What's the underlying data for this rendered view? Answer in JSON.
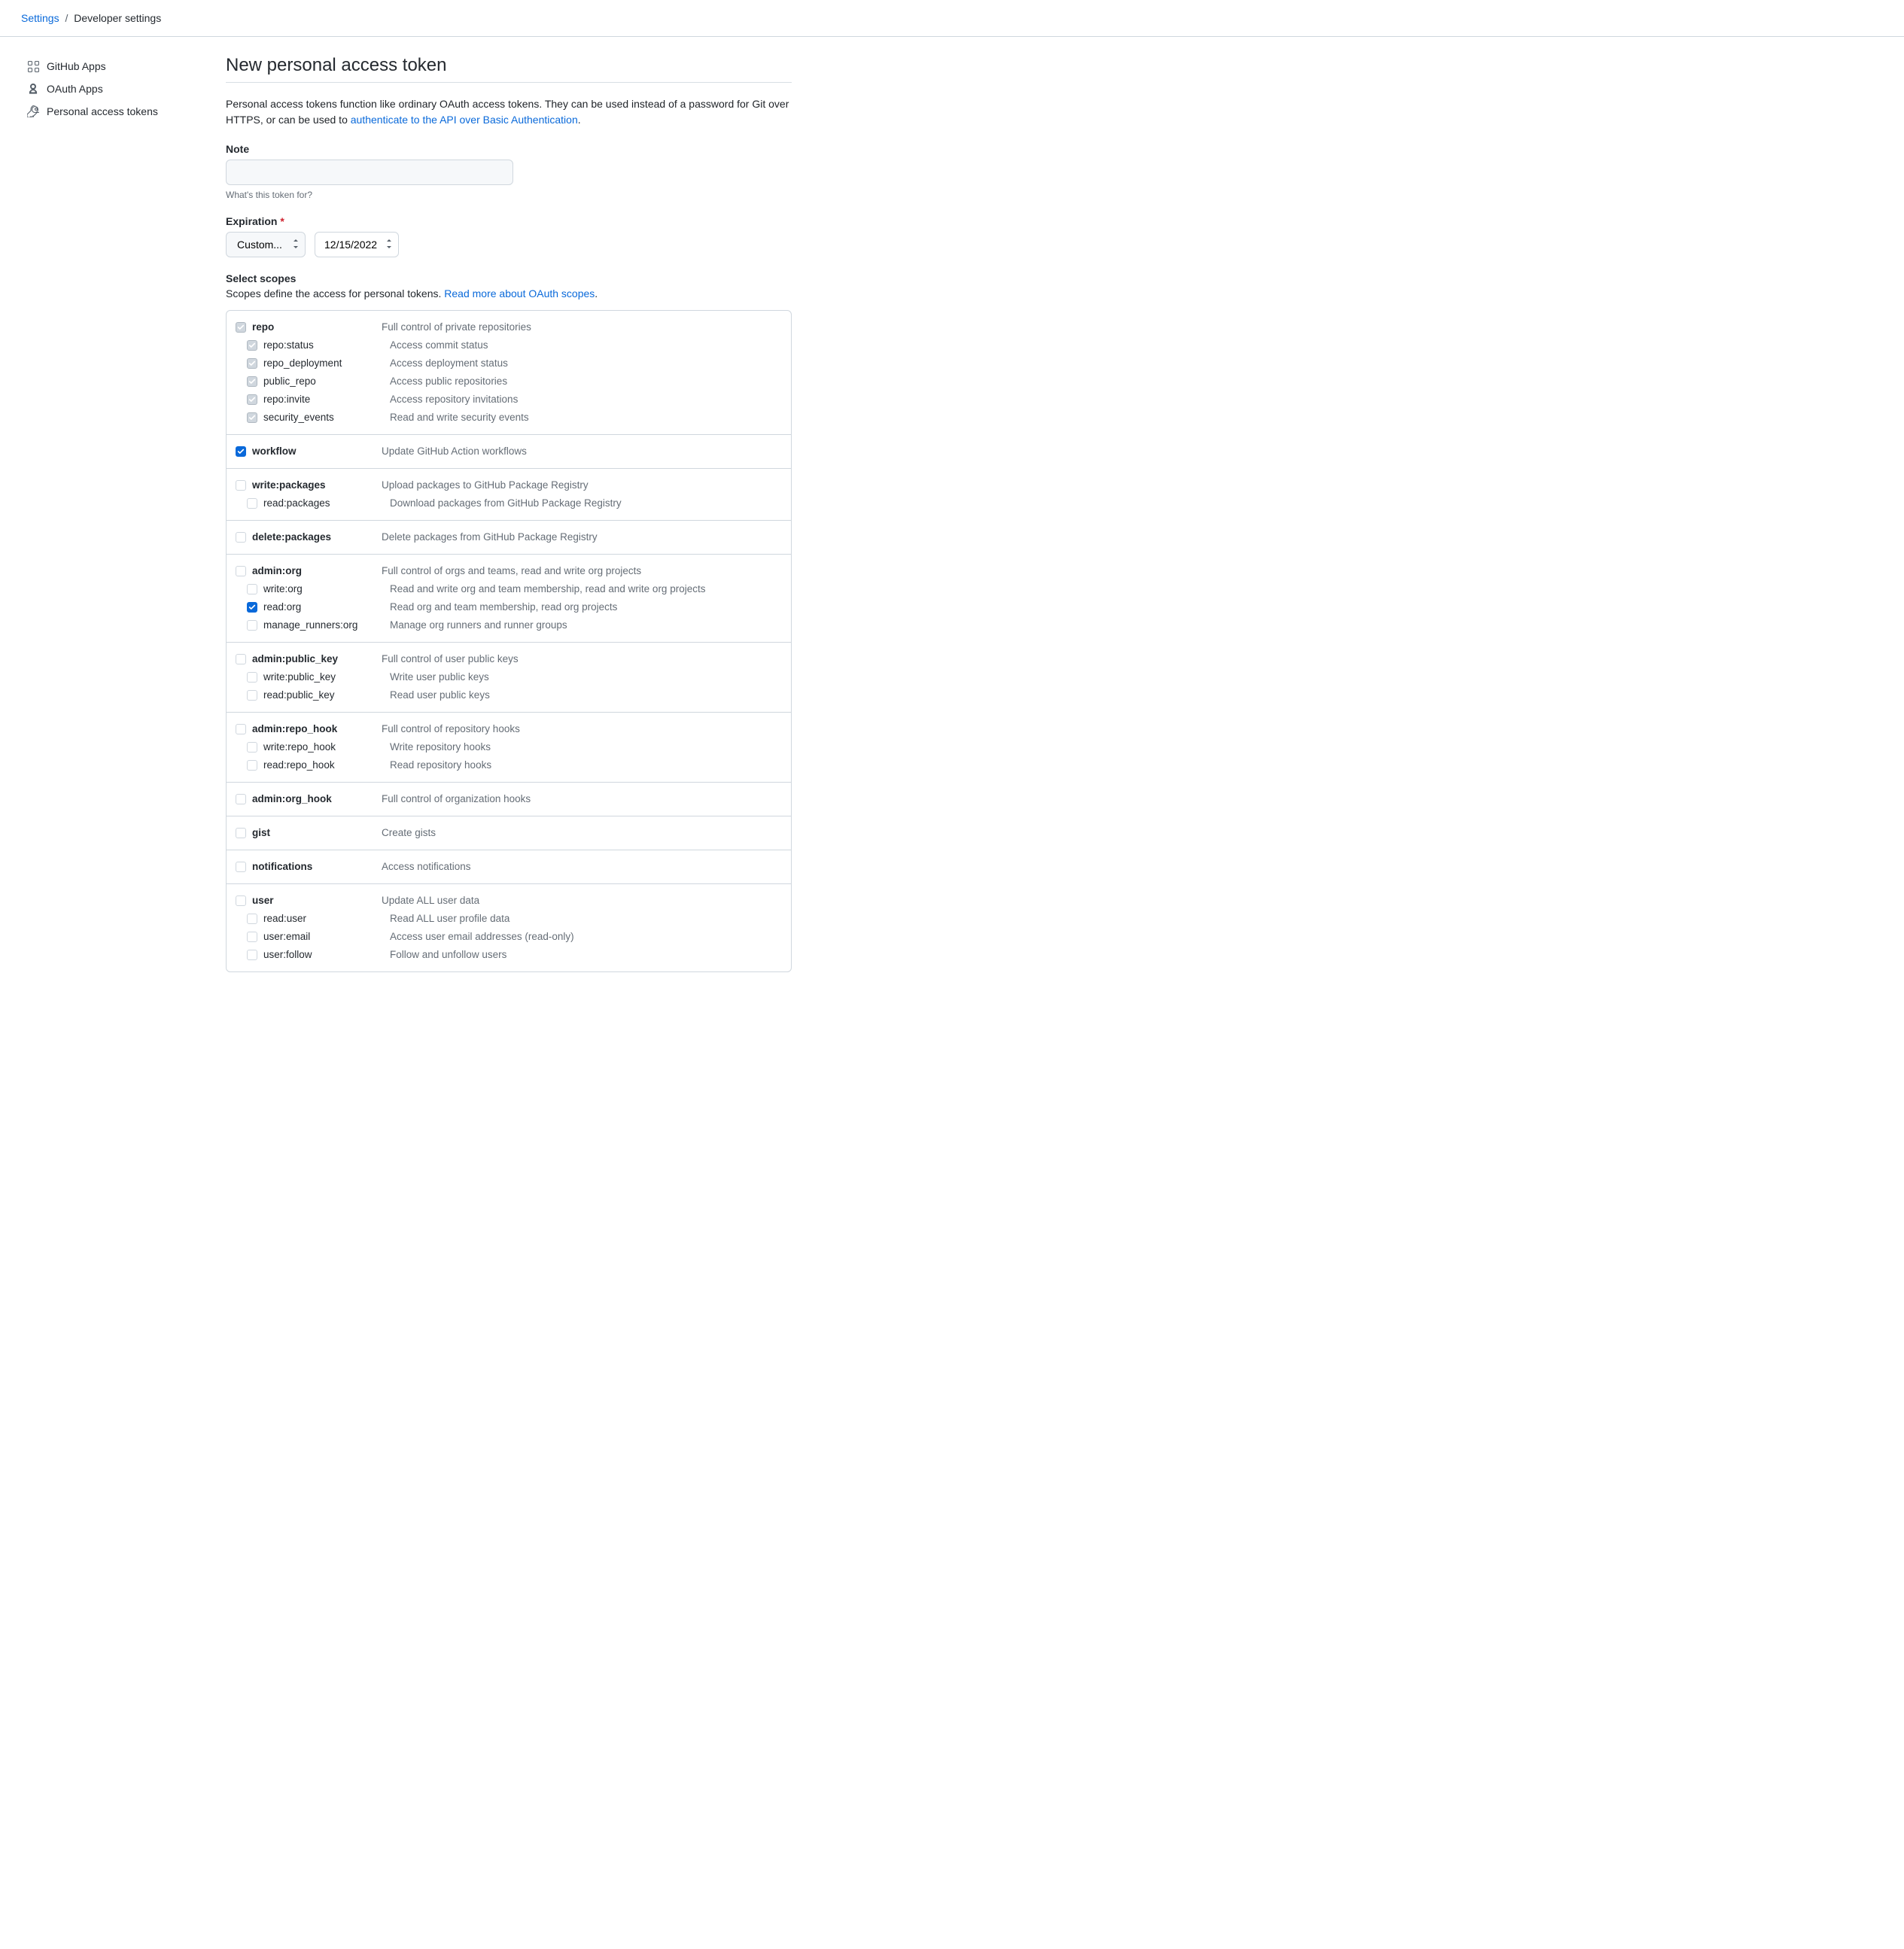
{
  "breadcrumb": {
    "settings": "Settings",
    "sep": "/",
    "current": "Developer settings"
  },
  "sidebar": {
    "items": [
      {
        "label": "GitHub Apps"
      },
      {
        "label": "OAuth Apps"
      },
      {
        "label": "Personal access tokens"
      }
    ]
  },
  "page": {
    "title": "New personal access token",
    "intro_pre": "Personal access tokens function like ordinary OAuth access tokens. They can be used instead of a password for Git over HTTPS, or can be used to ",
    "intro_link": "authenticate to the API over Basic Authentication",
    "intro_post": "."
  },
  "note": {
    "label": "Note",
    "value": "",
    "hint": "What's this token for?"
  },
  "expiration": {
    "label": "Expiration",
    "required": "*",
    "preset": "Custom...",
    "date": "12/15/2022"
  },
  "scopes": {
    "heading": "Select scopes",
    "desc_pre": "Scopes define the access for personal tokens. ",
    "desc_link": "Read more about OAuth scopes",
    "desc_post": "."
  },
  "scope_groups": [
    {
      "name": "repo",
      "desc": "Full control of private repositories",
      "state": "indet",
      "children": [
        {
          "name": "repo:status",
          "desc": "Access commit status",
          "state": "indet"
        },
        {
          "name": "repo_deployment",
          "desc": "Access deployment status",
          "state": "indet"
        },
        {
          "name": "public_repo",
          "desc": "Access public repositories",
          "state": "indet"
        },
        {
          "name": "repo:invite",
          "desc": "Access repository invitations",
          "state": "indet"
        },
        {
          "name": "security_events",
          "desc": "Read and write security events",
          "state": "indet"
        }
      ]
    },
    {
      "name": "workflow",
      "desc": "Update GitHub Action workflows",
      "state": "checked",
      "children": []
    },
    {
      "name": "write:packages",
      "desc": "Upload packages to GitHub Package Registry",
      "state": "off",
      "children": [
        {
          "name": "read:packages",
          "desc": "Download packages from GitHub Package Registry",
          "state": "off"
        }
      ]
    },
    {
      "name": "delete:packages",
      "desc": "Delete packages from GitHub Package Registry",
      "state": "off",
      "children": []
    },
    {
      "name": "admin:org",
      "desc": "Full control of orgs and teams, read and write org projects",
      "state": "off",
      "children": [
        {
          "name": "write:org",
          "desc": "Read and write org and team membership, read and write org projects",
          "state": "off"
        },
        {
          "name": "read:org",
          "desc": "Read org and team membership, read org projects",
          "state": "checked"
        },
        {
          "name": "manage_runners:org",
          "desc": "Manage org runners and runner groups",
          "state": "off"
        }
      ]
    },
    {
      "name": "admin:public_key",
      "desc": "Full control of user public keys",
      "state": "off",
      "children": [
        {
          "name": "write:public_key",
          "desc": "Write user public keys",
          "state": "off"
        },
        {
          "name": "read:public_key",
          "desc": "Read user public keys",
          "state": "off"
        }
      ]
    },
    {
      "name": "admin:repo_hook",
      "desc": "Full control of repository hooks",
      "state": "off",
      "children": [
        {
          "name": "write:repo_hook",
          "desc": "Write repository hooks",
          "state": "off"
        },
        {
          "name": "read:repo_hook",
          "desc": "Read repository hooks",
          "state": "off"
        }
      ]
    },
    {
      "name": "admin:org_hook",
      "desc": "Full control of organization hooks",
      "state": "off",
      "children": []
    },
    {
      "name": "gist",
      "desc": "Create gists",
      "state": "off",
      "children": []
    },
    {
      "name": "notifications",
      "desc": "Access notifications",
      "state": "off",
      "children": []
    },
    {
      "name": "user",
      "desc": "Update ALL user data",
      "state": "off",
      "children": [
        {
          "name": "read:user",
          "desc": "Read ALL user profile data",
          "state": "off"
        },
        {
          "name": "user:email",
          "desc": "Access user email addresses (read-only)",
          "state": "off"
        },
        {
          "name": "user:follow",
          "desc": "Follow and unfollow users",
          "state": "off"
        }
      ]
    }
  ]
}
